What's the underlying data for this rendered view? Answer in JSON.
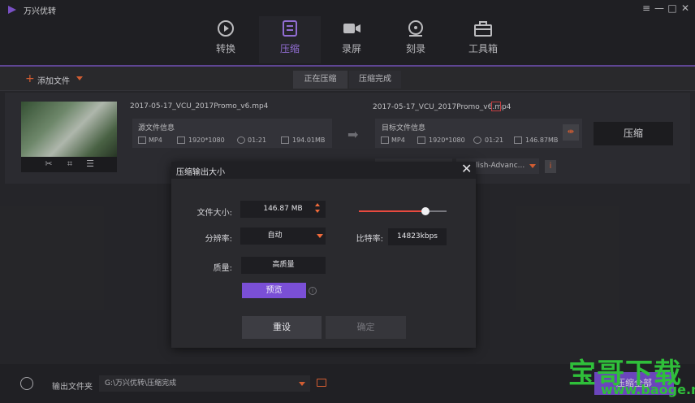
{
  "app": {
    "title": "万兴优转"
  },
  "window_controls": [
    "≡",
    "—",
    "□",
    "✕"
  ],
  "nav": [
    {
      "label": "转换",
      "icon": "convert-icon"
    },
    {
      "label": "压缩",
      "icon": "compress-icon",
      "active": true
    },
    {
      "label": "录屏",
      "icon": "record-icon"
    },
    {
      "label": "刻录",
      "icon": "burn-icon"
    },
    {
      "label": "工具箱",
      "icon": "toolbox-icon"
    }
  ],
  "toolbar": {
    "add_file": "添加文件"
  },
  "tabs": [
    "正在压缩",
    "压缩完成"
  ],
  "file": {
    "source_name": "2017-05-17_VCU_2017Promo_v6.mp4",
    "target_name": "2017-05-17_VCU_2017Promo_v6.mp4",
    "source_label": "源文件信息",
    "target_label": "目标文件信息",
    "source": {
      "format": "MP4",
      "resolution": "1920*1080",
      "duration": "01:21",
      "size": "194.01MB"
    },
    "target": {
      "format": "MP4",
      "resolution": "1920*1080",
      "duration": "01:21",
      "size": "146.87MB"
    },
    "compress_button": "压缩",
    "preset": "lish-Advanc..."
  },
  "bottom": {
    "output_label": "输出文件夹",
    "output_path": "G:\\万兴优转\\压缩完成",
    "compress_all": "压缩全部"
  },
  "modal": {
    "title": "压缩输出大小",
    "file_size_label": "文件大小:",
    "file_size_value": "146.87  MB",
    "size_fraction": 0.757,
    "resolution_label": "分辨率:",
    "resolution_value": "自动",
    "bitrate_label": "比特率:",
    "bitrate_value": "14823kbps",
    "quality_label": "质量:",
    "quality_value": "高质量",
    "preview_button": "预览",
    "reset_button": "重设",
    "ok_button": "确定"
  },
  "watermark": {
    "text": "宝哥下载",
    "url": "www.baoge.net"
  },
  "colors": {
    "accent": "#7a4fd6",
    "orange": "#f06a3a",
    "red": "#e84a3f"
  }
}
